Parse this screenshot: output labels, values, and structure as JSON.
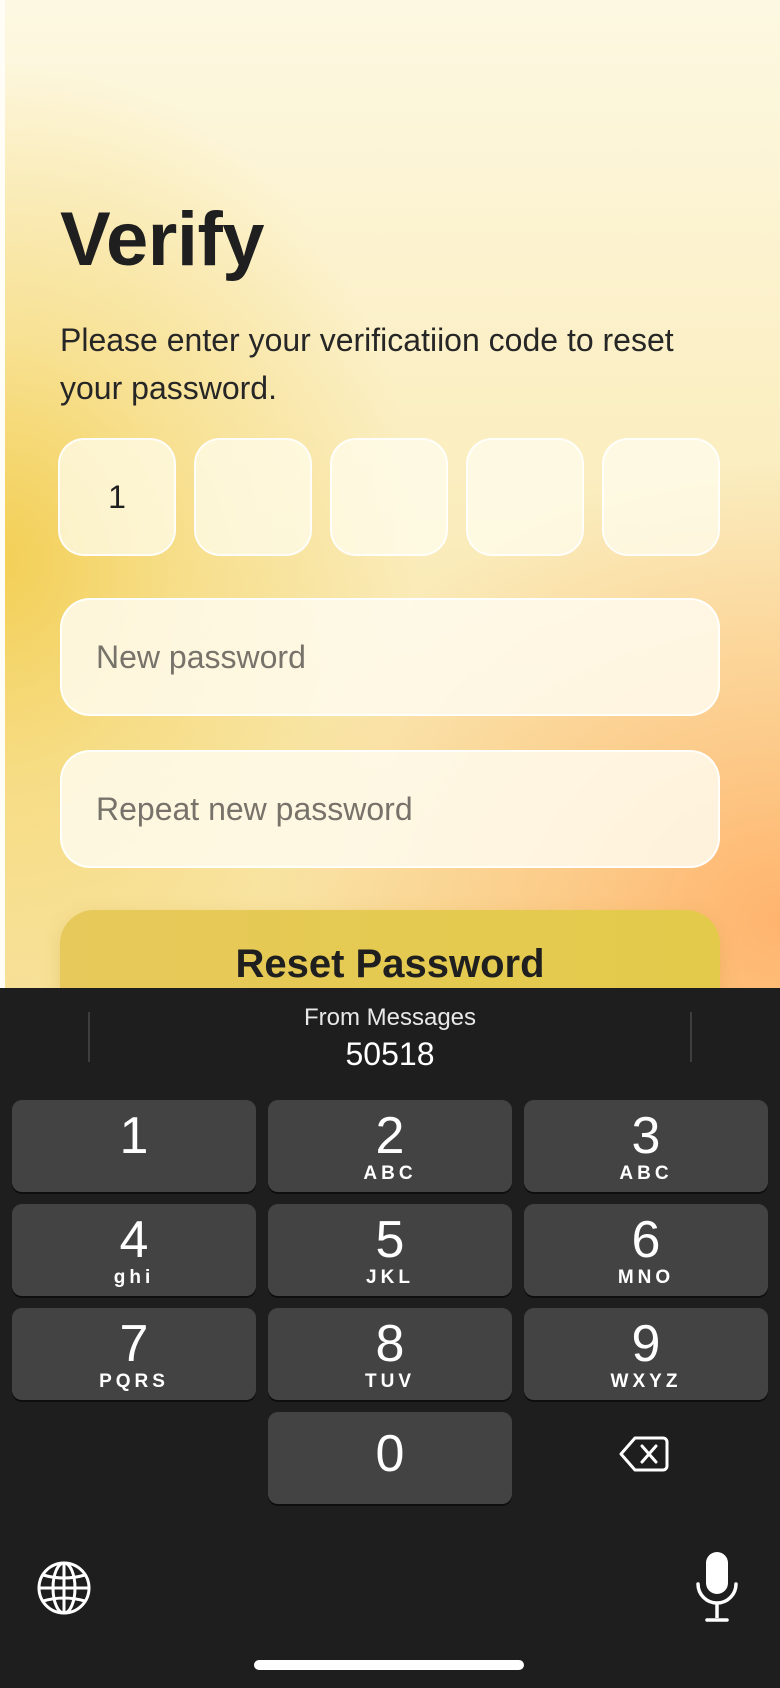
{
  "screen": {
    "title": "Verify",
    "subtitle": "Please enter your verificatiion code to reset your password.",
    "code_digits": [
      "1",
      "",
      "",
      "",
      ""
    ],
    "new_password": {
      "value": "",
      "placeholder": "New password"
    },
    "repeat_password": {
      "value": "",
      "placeholder": "Repeat new password"
    },
    "reset_label": "Reset Password"
  },
  "keyboard": {
    "suggestion_source": "From Messages",
    "suggestion_code": "50518",
    "keys": [
      {
        "num": "1",
        "letters": ""
      },
      {
        "num": "2",
        "letters": "ABC"
      },
      {
        "num": "3",
        "letters": "ABC"
      },
      {
        "num": "4",
        "letters": "ghi"
      },
      {
        "num": "5",
        "letters": "JKL"
      },
      {
        "num": "6",
        "letters": "MNO"
      },
      {
        "num": "7",
        "letters": "PQRS"
      },
      {
        "num": "8",
        "letters": "TUV"
      },
      {
        "num": "9",
        "letters": "WXYZ"
      },
      {
        "num": "0",
        "letters": ""
      }
    ],
    "icons": {
      "delete": "backspace-icon",
      "globe": "globe-icon",
      "mic": "microphone-icon"
    }
  },
  "colors": {
    "accent_button": "#e4ca4a",
    "keyboard_bg": "#1e1e1e",
    "key_bg": "#434343"
  }
}
